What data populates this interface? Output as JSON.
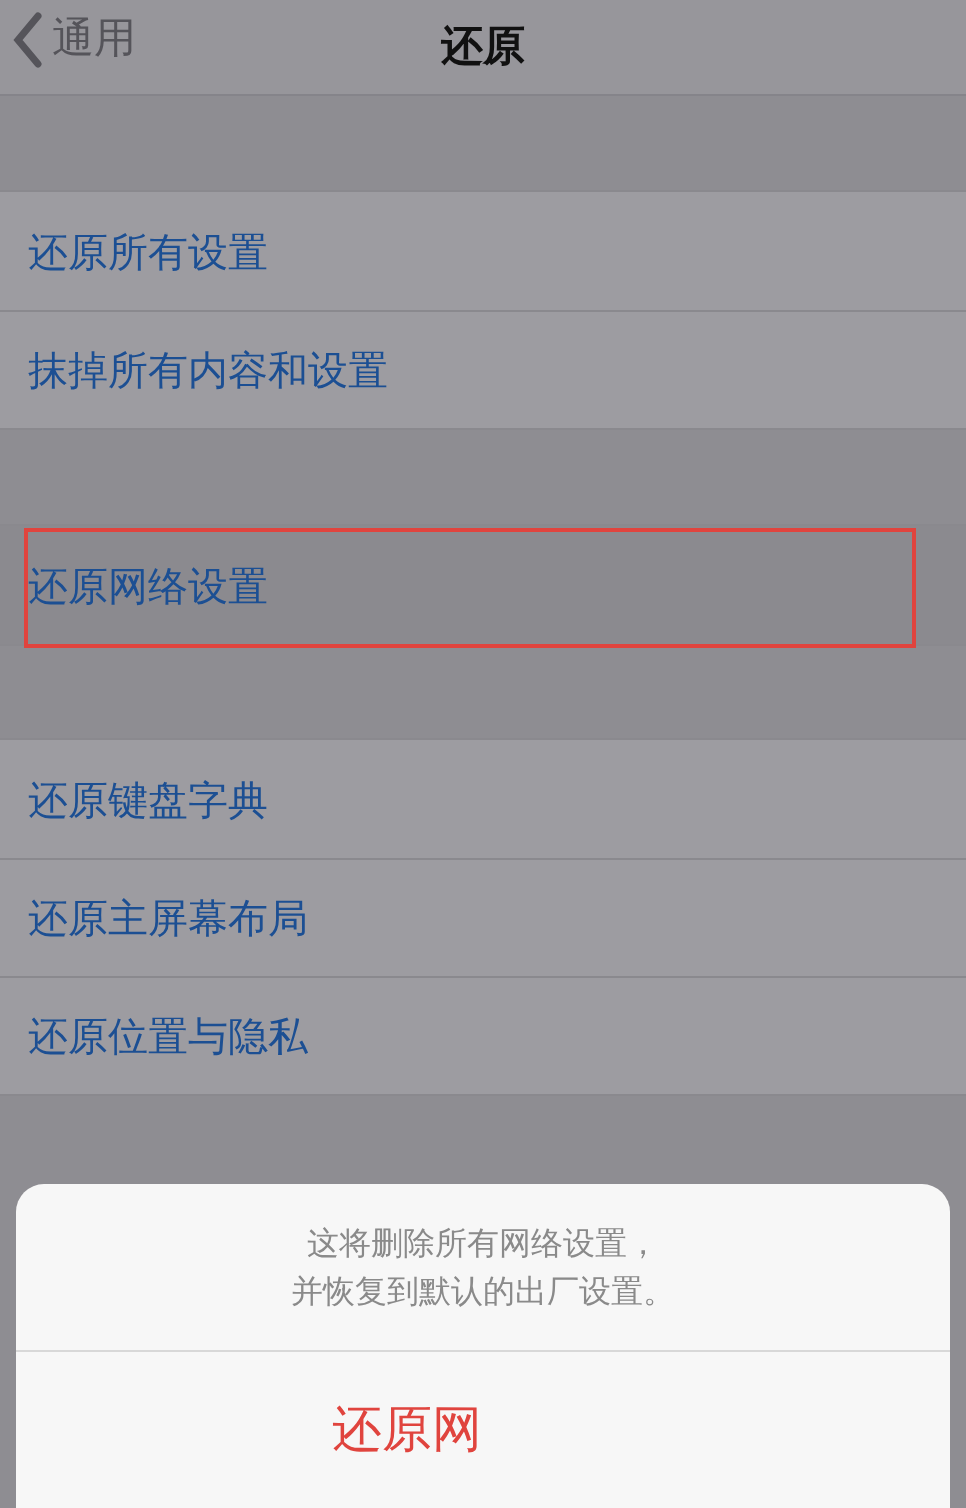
{
  "nav": {
    "back_label": "通用",
    "title": "还原"
  },
  "sections": [
    {
      "rows": [
        {
          "label": "还原所有设置",
          "selected": false
        },
        {
          "label": "抹掉所有内容和设置",
          "selected": false
        }
      ]
    },
    {
      "rows": [
        {
          "label": "还原网络设置",
          "selected": true
        }
      ]
    },
    {
      "rows": [
        {
          "label": "还原键盘字典",
          "selected": false
        },
        {
          "label": "还原主屏幕布局",
          "selected": false
        },
        {
          "label": "还原位置与隐私",
          "selected": false
        }
      ]
    }
  ],
  "action_sheet": {
    "message_lines": [
      "这将删除所有网络设置，",
      "并恢复到默认的出厂设置。"
    ],
    "destructive_button": "还原网"
  }
}
